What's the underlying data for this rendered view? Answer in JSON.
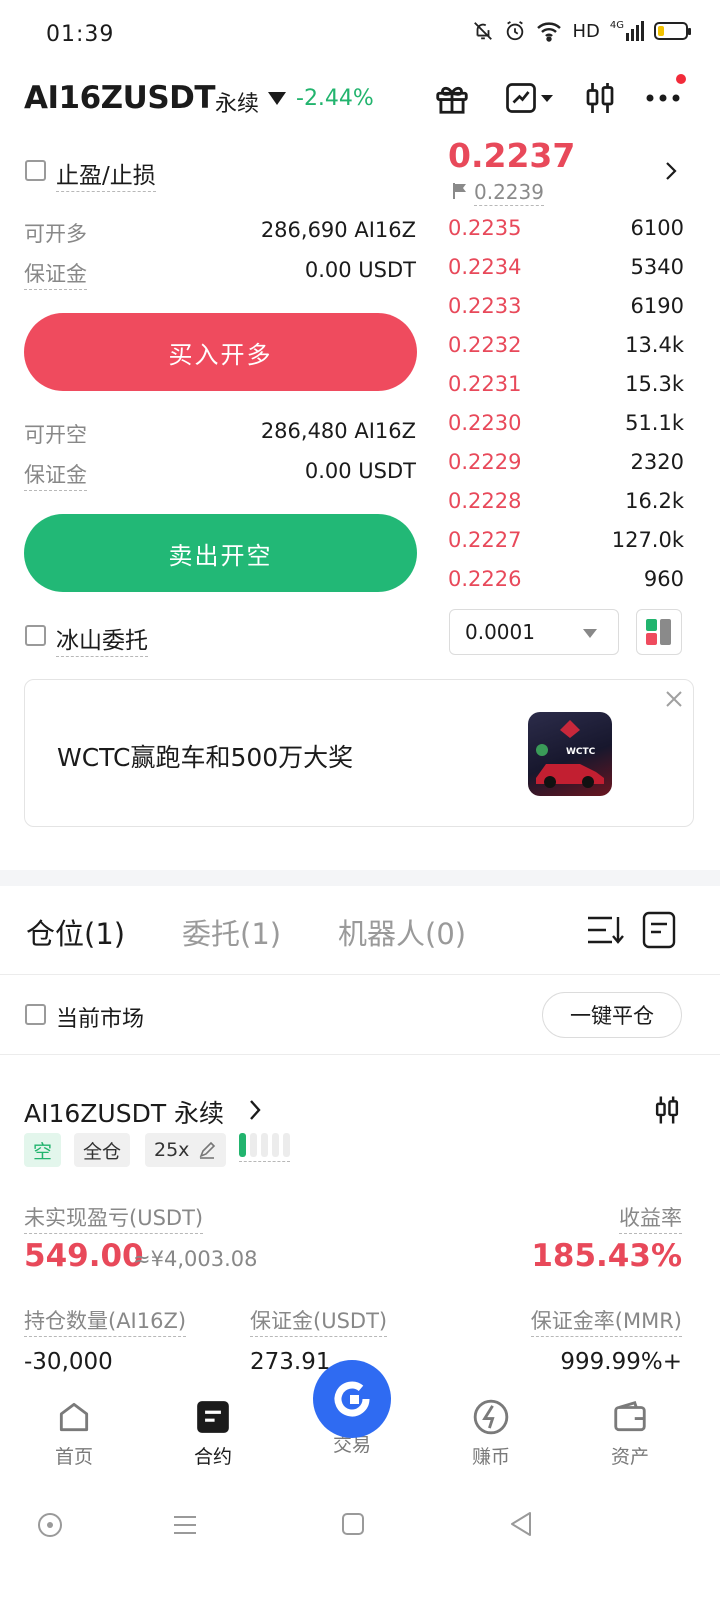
{
  "status_bar": {
    "time": "01:39",
    "network": "HD",
    "signal": "4G"
  },
  "header": {
    "symbol": "AI16ZUSDT",
    "contract_type": "永续",
    "change": "-2.44%"
  },
  "order_form": {
    "tp_sl_label": "止盈/止损",
    "long_available_label": "可开多",
    "long_available_value": "286,690 AI16Z",
    "long_margin_label": "保证金",
    "long_margin_value": "0.00 USDT",
    "buy_button": "买入开多",
    "short_available_label": "可开空",
    "short_available_value": "286,480 AI16Z",
    "short_margin_label": "保证金",
    "short_margin_value": "0.00 USDT",
    "sell_button": "卖出开空",
    "iceberg_label": "冰山委托"
  },
  "orderbook": {
    "last_price": "0.2237",
    "mark_price": "0.2239",
    "asks": [
      {
        "price": "0.2235",
        "qty": "6100"
      },
      {
        "price": "0.2234",
        "qty": "5340"
      },
      {
        "price": "0.2233",
        "qty": "6190"
      },
      {
        "price": "0.2232",
        "qty": "13.4k"
      },
      {
        "price": "0.2231",
        "qty": "15.3k"
      },
      {
        "price": "0.2230",
        "qty": "51.1k"
      },
      {
        "price": "0.2229",
        "qty": "2320"
      },
      {
        "price": "0.2228",
        "qty": "16.2k"
      },
      {
        "price": "0.2227",
        "qty": "127.0k"
      },
      {
        "price": "0.2226",
        "qty": "960"
      }
    ],
    "precision": "0.0001"
  },
  "banner": {
    "text": "WCTC赢跑车和500万大奖"
  },
  "tabs": [
    {
      "label": "仓位(1)"
    },
    {
      "label": "委托(1)"
    },
    {
      "label": "机器人(0)"
    }
  ],
  "filter": {
    "current_market_label": "当前市场",
    "close_all_button": "一键平仓"
  },
  "position": {
    "symbol": "AI16ZUSDT 永续",
    "side_tag": "空",
    "margin_mode_tag": "全仓",
    "leverage_tag": "25x",
    "unrealized_pnl_label": "未实现盈亏(USDT)",
    "unrealized_pnl": "549.00",
    "unrealized_pnl_cny": "≈¥4,003.08",
    "roe_label": "收益率",
    "roe": "185.43%",
    "size_label": "持仓数量(AI16Z)",
    "size": "-30,000",
    "margin_label": "保证金(USDT)",
    "margin": "273.91",
    "mmr_label": "保证金率(MMR)",
    "mmr": "999.99%+"
  },
  "bottom_nav": [
    {
      "label": "首页"
    },
    {
      "label": "合约"
    },
    {
      "label": "交易"
    },
    {
      "label": "赚币"
    },
    {
      "label": "资产"
    }
  ],
  "colors": {
    "red": "#e8495a",
    "green": "#22b46e",
    "blue": "#2f6bf2"
  }
}
